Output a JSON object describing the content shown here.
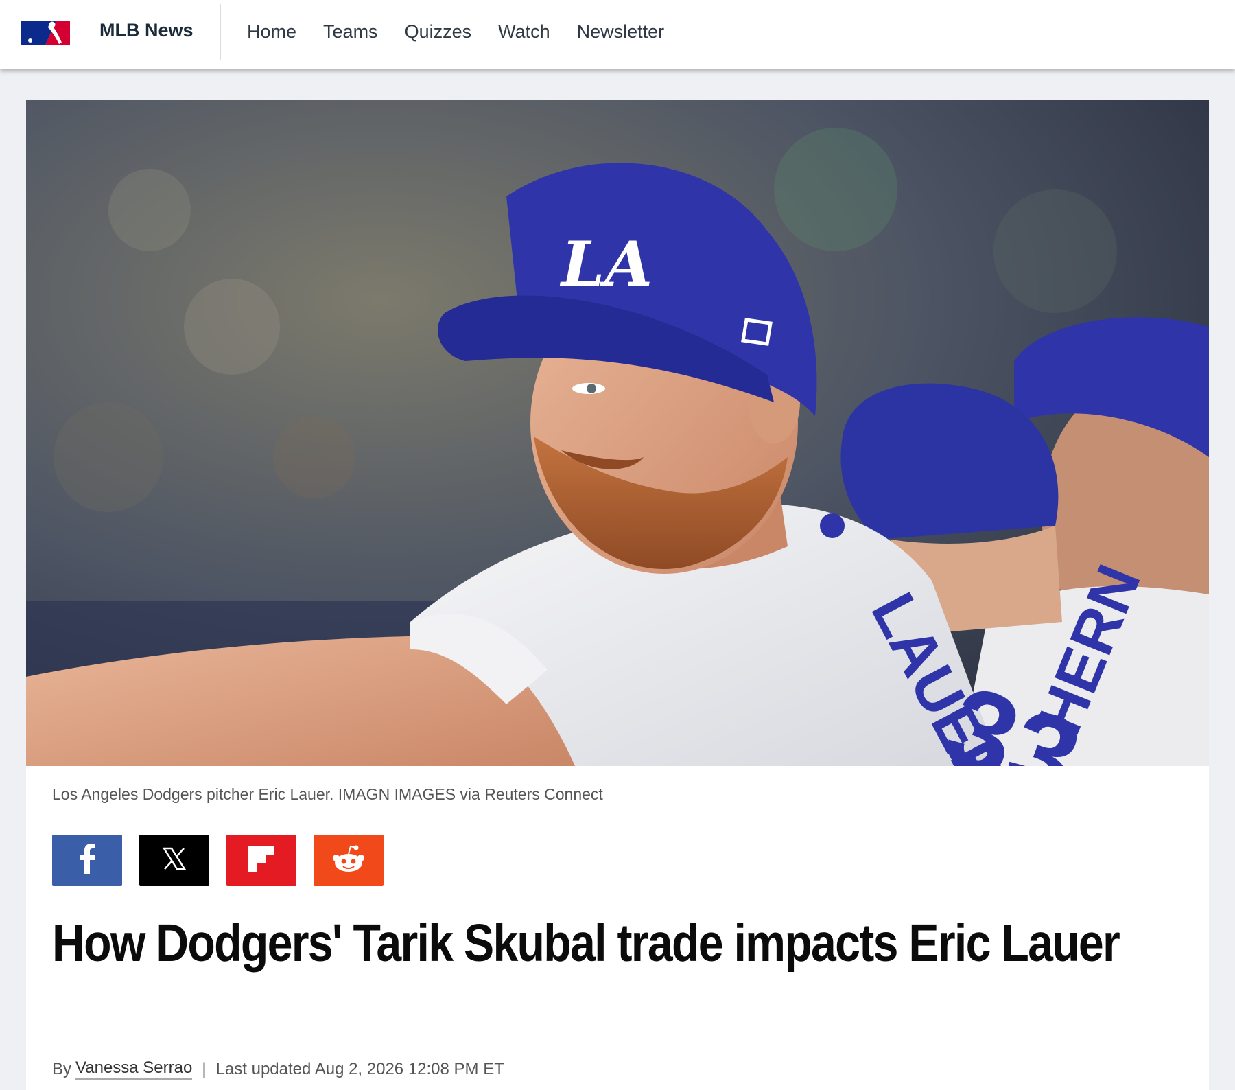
{
  "header": {
    "brand": "MLB News",
    "nav": [
      {
        "label": "Home"
      },
      {
        "label": "Teams"
      },
      {
        "label": "Quizzes"
      },
      {
        "label": "Watch"
      },
      {
        "label": "Newsletter"
      }
    ]
  },
  "article": {
    "hero_caption": "Los Angeles Dodgers pitcher Eric Lauer. IMAGN IMAGES via Reuters Connect",
    "share": [
      {
        "icon": "facebook-icon",
        "color": "#3b5ea8"
      },
      {
        "icon": "x-icon",
        "color": "#000000"
      },
      {
        "icon": "flipboard-icon",
        "color": "#e41b23"
      },
      {
        "icon": "reddit-icon",
        "color": "#f2491b"
      }
    ],
    "headline": "How Dodgers' Tarik Skubal trade impacts Eric Lauer",
    "byline_prefix": "By",
    "author": "Vanessa Serrao",
    "separator": "|",
    "updated": "Last updated Aug 2, 2026 12:08 PM ET"
  },
  "colors": {
    "dodger_blue": "#2f35a8",
    "mlb_blue": "#041e8c",
    "mlb_red": "#d50032"
  }
}
